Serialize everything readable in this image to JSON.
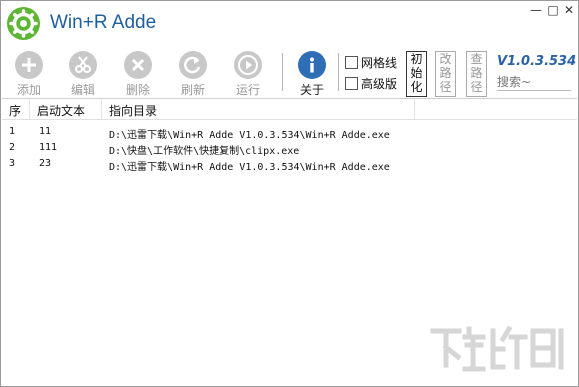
{
  "app": {
    "title": "Win+R Adde"
  },
  "window_controls": {
    "minimize": "—",
    "maximize": "□",
    "close": "✕"
  },
  "toolbar": {
    "buttons": [
      {
        "id": "add",
        "label": "添加",
        "icon": "plus-icon"
      },
      {
        "id": "edit",
        "label": "编辑",
        "icon": "scissors-icon"
      },
      {
        "id": "delete",
        "label": "删除",
        "icon": "x-circle-icon"
      },
      {
        "id": "refresh",
        "label": "刷新",
        "icon": "refresh-icon"
      },
      {
        "id": "run",
        "label": "运行",
        "icon": "play-icon"
      },
      {
        "id": "about",
        "label": "关于",
        "icon": "info-icon"
      }
    ],
    "checkboxes": [
      {
        "label": "网格线",
        "checked": false
      },
      {
        "label": "高级版",
        "checked": false
      }
    ],
    "vertical_buttons": [
      {
        "label": "初始化"
      },
      {
        "label": "改路径"
      },
      {
        "label": "查路径"
      }
    ],
    "version": "V1.0.3.534",
    "search_placeholder": "搜索~"
  },
  "table": {
    "headers": [
      "序",
      "启动文本",
      "指向目录"
    ],
    "rows": [
      [
        "1",
        "11",
        "D:\\迅雷下载\\Win+R Adde V1.0.3.534\\Win+R Adde.exe"
      ],
      [
        "2",
        "111",
        "D:\\快盘\\工作软件\\快捷复制\\clipx.exe"
      ],
      [
        "3",
        "23",
        "D:\\迅雷下载\\Win+R Adde V1.0.3.534\\Win+R Adde.exe"
      ]
    ]
  },
  "colors": {
    "accent": "#2f6db5",
    "logo": "#5cb533",
    "title": "#1f5fa0"
  }
}
